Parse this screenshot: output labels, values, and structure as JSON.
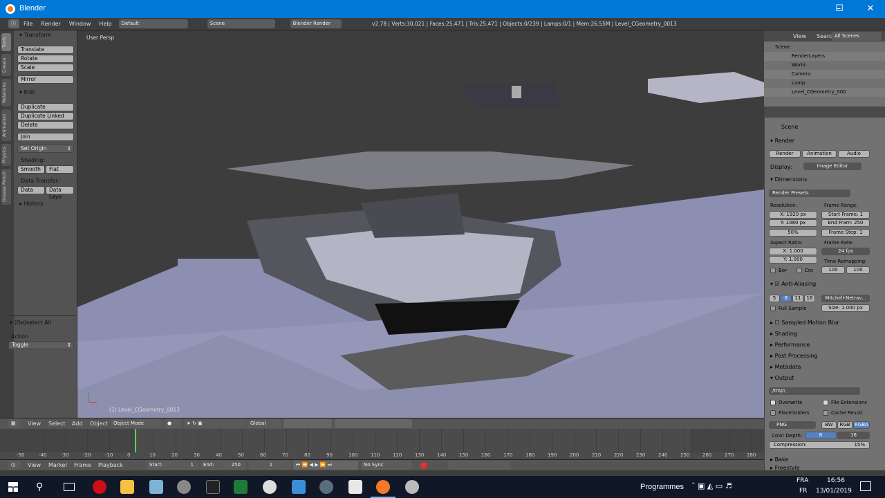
{
  "window": {
    "title": "Blender"
  },
  "topbar": {
    "menus": [
      "File",
      "Render",
      "Window",
      "Help"
    ],
    "layout": "Default",
    "scene": "Scene",
    "engine": "Blender Render",
    "stats": "v2.78 | Verts:30,021 | Faces:25,471 | Tris:25,471 | Objects:0/239 | Lamps:0/1 | Mem:26.55M | Level_CGeometry_0013"
  },
  "toolshelf": {
    "tabs": [
      "Tools",
      "Create",
      "Relations",
      "Animation",
      "Physics",
      "Grease Pencil"
    ],
    "transform_header": "Transform",
    "translate": "Translate",
    "rotate": "Rotate",
    "scale": "Scale",
    "mirror": "Mirror",
    "edit_header": "Edit",
    "duplicate": "Duplicate",
    "duplicate_linked": "Duplicate Linked",
    "delete": "Delete",
    "join": "Join",
    "set_origin": "Set Origin",
    "shading_label": "Shading:",
    "smooth": "Smooth",
    "flat": "Flat",
    "data_transfer_label": "Data Transfer:",
    "data": "Data",
    "data_layo": "Data Layo",
    "history": "History",
    "operator_header": "(De)select All",
    "action_label": "Action",
    "action_value": "Toggle"
  },
  "viewport": {
    "view_label": "User Persp",
    "object_label": "(1) Level_CGeometry_0013"
  },
  "v3dheader": {
    "view": "View",
    "select": "Select",
    "add": "Add",
    "object": "Object",
    "mode": "Object Mode",
    "orientation": "Global"
  },
  "timeline": {
    "ticks": [
      "-50",
      "-40",
      "-30",
      "-20",
      "-10",
      "0",
      "10",
      "20",
      "30",
      "40",
      "50",
      "60",
      "70",
      "80",
      "90",
      "100",
      "110",
      "120",
      "130",
      "140",
      "150",
      "160",
      "170",
      "180",
      "190",
      "200",
      "210",
      "220",
      "230",
      "240",
      "250",
      "260",
      "270",
      "280"
    ],
    "view": "View",
    "marker": "Marker",
    "frame": "Frame",
    "playback": "Playback",
    "start": "Start:",
    "start_val": "1",
    "end": "End:",
    "end_val": "250",
    "current": "1",
    "sync": "No Sync"
  },
  "outliner": {
    "view": "View",
    "search": "Search",
    "filter": "All Scenes",
    "items": [
      "Scene",
      "RenderLayers",
      "World",
      "Camera",
      "Lamp",
      "Level_CGeometry_000"
    ]
  },
  "properties": {
    "context": "Scene",
    "render_header": "Render",
    "tab_render": "Render",
    "tab_animation": "Animation",
    "tab_audio": "Audio",
    "display_label": "Display:",
    "display_value": "Image Editor",
    "dimensions_header": "Dimensions",
    "presets": "Render Presets",
    "resolution_label": "Resolution:",
    "res_x": "X:",
    "res_x_val": "1920 px",
    "res_y": "Y:",
    "res_y_val": "1080 px",
    "res_pct": "50%",
    "frame_range_label": "Frame Range:",
    "start_frame": "Start Frame:",
    "start_frame_val": "1",
    "end_frame": "End Fram:",
    "end_frame_val": "250",
    "frame_step": "Frame Step:",
    "frame_step_val": "1",
    "aspect_label": "Aspect Ratio:",
    "asp_x": "X:",
    "asp_x_val": "1.000",
    "asp_y": "Y:",
    "asp_y_val": "1.000",
    "frame_rate_label": "Frame Rate:",
    "frame_rate": "24 fps",
    "border": "Bor",
    "crop": "Cro",
    "time_remap_label": "Time Remapping:",
    "remap_old": "100",
    "remap_new": "100",
    "aa_header": "Anti-Aliasing",
    "aa_samples": [
      "5",
      "8",
      "11",
      "16"
    ],
    "aa_filter": "Mitchell-Netrav...",
    "full_sample": "Full Sample",
    "aa_size": "Size: 1.000 px",
    "motion_blur": "Sampled Motion Blur",
    "shading": "Shading",
    "performance": "Performance",
    "post_processing": "Post Processing",
    "metadata": "Metadata",
    "output_header": "Output",
    "output_path": "/tmp\\",
    "overwrite": "Overwrite",
    "file_extensions": "File Extensions",
    "placeholders": "Placeholders",
    "cache_result": "Cache Result",
    "format": "PNG",
    "bw": "BW",
    "rgb": "RGB",
    "rgba": "RGBA",
    "color_depth_label": "Color Depth:",
    "depth_8": "8",
    "depth_16": "16",
    "compression": "Compression:",
    "compression_val": "15%",
    "bake": "Bake",
    "freestyle": "Freestyle"
  },
  "taskbar": {
    "programmes": "Programmes",
    "lang": "FRA",
    "lang2": "FR",
    "time": "16:56",
    "date": "13/01/2019"
  }
}
